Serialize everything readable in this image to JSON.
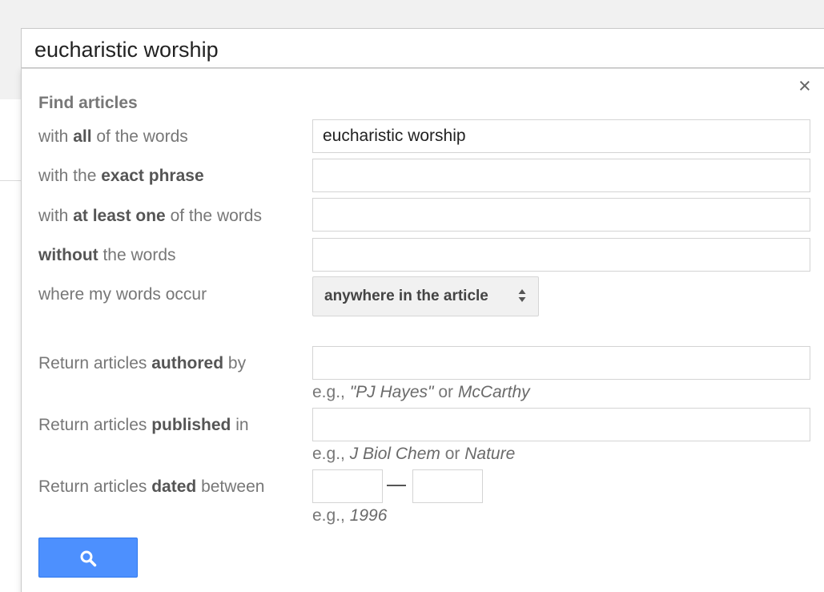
{
  "search_bar": {
    "query": "eucharistic worship"
  },
  "dialog": {
    "close_symbol": "×",
    "heading": "Find articles",
    "rows": {
      "all_words": {
        "pre": "with ",
        "bold": "all",
        "post": " of the words",
        "value": "eucharistic worship"
      },
      "exact_phrase": {
        "pre": "with the ",
        "bold": "exact phrase",
        "post": "",
        "value": ""
      },
      "at_least_one": {
        "pre": "with ",
        "bold": "at least one",
        "post": " of the words",
        "value": ""
      },
      "without_words": {
        "pre": "",
        "bold": "without",
        "post": " the words",
        "value": ""
      },
      "occur": {
        "label": "where my words occur",
        "selected": "anywhere in the article"
      },
      "authored": {
        "pre": "Return articles ",
        "bold": "authored",
        "post": " by",
        "value": "",
        "hint_pre": "e.g., ",
        "hint_i1": "\"PJ Hayes\"",
        "hint_mid": " or ",
        "hint_i2": "McCarthy"
      },
      "published": {
        "pre": "Return articles ",
        "bold": "published",
        "post": " in",
        "value": "",
        "hint_pre": "e.g., ",
        "hint_i1": "J Biol Chem",
        "hint_mid": " or ",
        "hint_i2": "Nature"
      },
      "dated": {
        "pre": "Return articles ",
        "bold": "dated",
        "post": " between",
        "from": "",
        "to": "",
        "hint_pre": "e.g., ",
        "hint_i1": "1996"
      }
    },
    "search_button": {
      "icon": "magnifier-icon",
      "color": "#4d90fe"
    }
  }
}
